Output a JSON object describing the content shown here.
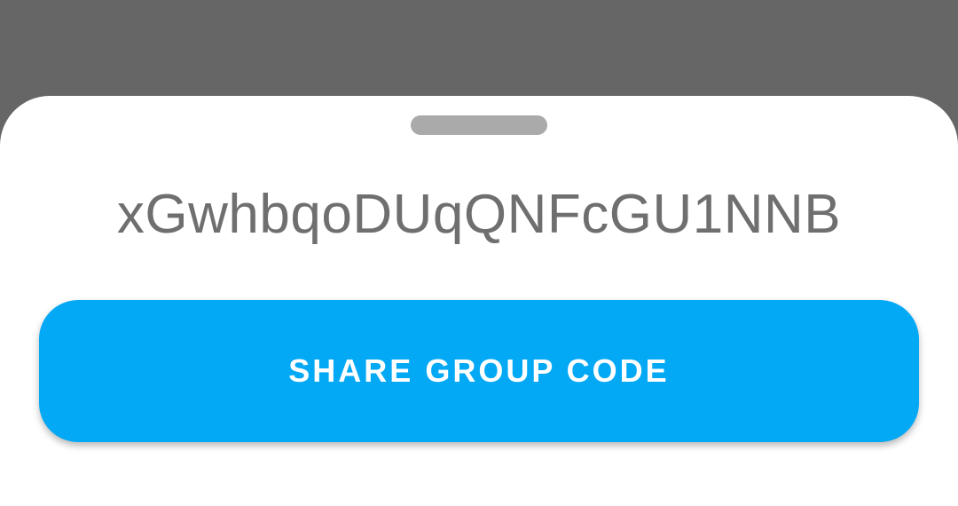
{
  "sheet": {
    "group_code": "xGwhbqoDUqQNFcGU1NNB",
    "share_button_label": "SHARE GROUP CODE"
  },
  "colors": {
    "scrim": "#666666",
    "sheet_background": "#ffffff",
    "handle": "#aaaaaa",
    "code_text": "#6f6f6f",
    "button_background": "#03a9f4",
    "button_text": "#ffffff"
  }
}
